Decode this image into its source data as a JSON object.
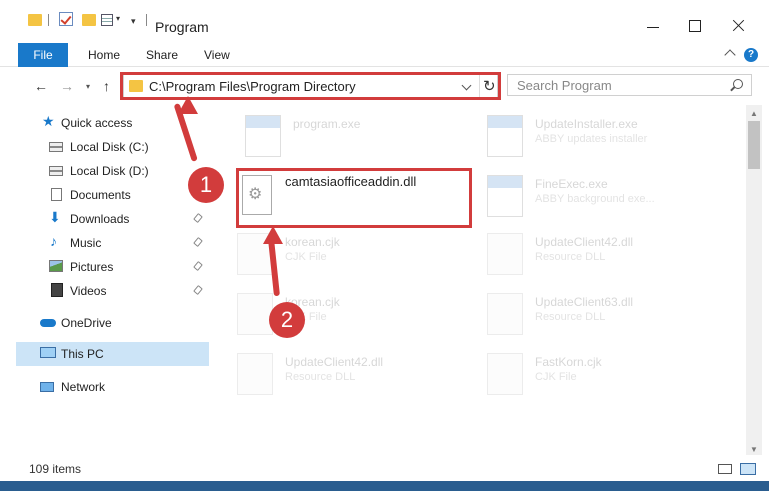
{
  "window": {
    "title": "Program"
  },
  "ribbon": {
    "tabs": [
      "File",
      "Home",
      "Share",
      "View"
    ]
  },
  "nav": {
    "address": "C:\\Program Files\\Program Directory",
    "search_placeholder": "Search Program"
  },
  "sidebar": {
    "items": [
      {
        "label": "Quick access",
        "icon": "star-icon"
      },
      {
        "label": "Local Disk (C:)",
        "icon": "disk-icon"
      },
      {
        "label": "Local Disk (D:)",
        "icon": "disk-icon"
      },
      {
        "label": "Documents",
        "icon": "documents-icon",
        "pinned": true
      },
      {
        "label": "Downloads",
        "icon": "download-icon",
        "pinned": true
      },
      {
        "label": "Music",
        "icon": "music-icon",
        "pinned": true
      },
      {
        "label": "Pictures",
        "icon": "pictures-icon",
        "pinned": true
      },
      {
        "label": "Videos",
        "icon": "videos-icon",
        "pinned": true
      },
      {
        "label": "OneDrive",
        "icon": "onedrive-icon"
      },
      {
        "label": "This PC",
        "icon": "pc-icon",
        "selected": true
      },
      {
        "label": "Network",
        "icon": "network-icon"
      }
    ]
  },
  "files": {
    "focused": "camtasiaofficeaddin.dll",
    "items": [
      {
        "name": "program.exe",
        "sub": "",
        "type": "exe"
      },
      {
        "name": "UpdateInstaller.exe",
        "sub": "ABBY updates installer",
        "type": "exe"
      },
      {
        "name": "FineExec.exe",
        "sub": "ABBY background exe...",
        "type": "exe"
      },
      {
        "name": "korean.cjk",
        "sub": "CJK File",
        "type": "doc"
      },
      {
        "name": "UpdateClient42.dll",
        "sub": "Resource DLL",
        "type": "dll"
      },
      {
        "name": "korean.cjk",
        "sub": "CJK File",
        "type": "doc"
      },
      {
        "name": "UpdateClient63.dll",
        "sub": "Resource DLL",
        "type": "dll"
      },
      {
        "name": "UpdateClient42.dll",
        "sub": "Resource DLL",
        "type": "dll"
      },
      {
        "name": "FastKorn.cjk",
        "sub": "CJK File",
        "type": "doc"
      }
    ]
  },
  "status": {
    "count": "109 items"
  },
  "annotations": {
    "step1": "1",
    "step2": "2"
  },
  "colors": {
    "accent": "#1979ca",
    "highlight": "#d23c3c",
    "selected": "#cce4f7"
  }
}
